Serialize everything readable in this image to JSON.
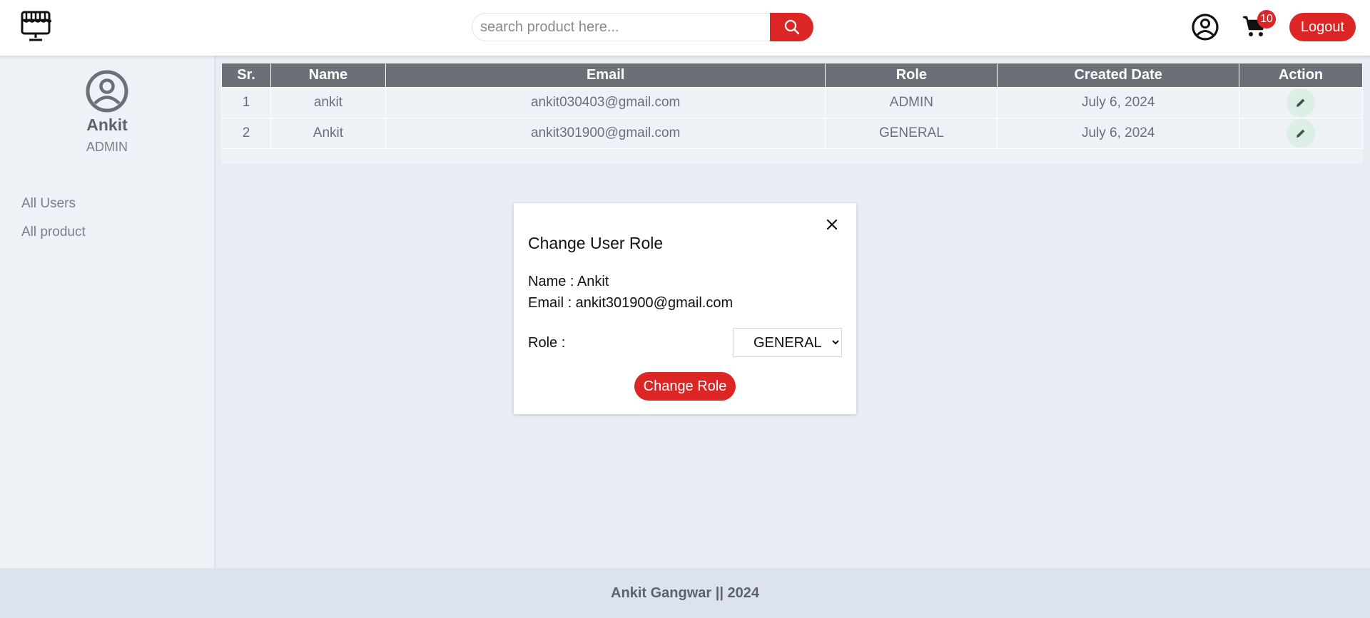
{
  "header": {
    "logo_icon": "storefront-monitor-icon",
    "search_placeholder": "search product here...",
    "search_icon": "search-icon",
    "user_icon": "user-circle-icon",
    "cart_icon": "cart-icon",
    "cart_count": "10",
    "logout_label": "Logout"
  },
  "sidebar": {
    "avatar_icon": "user-circle-icon",
    "user_name": "Ankit",
    "user_role": "ADMIN",
    "nav": [
      {
        "label": "All Users"
      },
      {
        "label": "All product"
      }
    ]
  },
  "table": {
    "headers": [
      "Sr.",
      "Name",
      "Email",
      "Role",
      "Created Date",
      "Action"
    ],
    "rows": [
      {
        "sr": "1",
        "name": "ankit",
        "email": "ankit030403@gmail.com",
        "role": "ADMIN",
        "created": "July 6, 2024",
        "action_icon": "pencil-icon"
      },
      {
        "sr": "2",
        "name": "Ankit",
        "email": "ankit301900@gmail.com",
        "role": "GENERAL",
        "created": "July 6, 2024",
        "action_icon": "pencil-icon"
      }
    ]
  },
  "modal": {
    "title": "Change User Role",
    "close_icon": "close-icon",
    "name_line": "Name : Ankit",
    "email_line": "Email : ankit301900@gmail.com",
    "role_label": "Role :",
    "role_selected": "GENERAL",
    "submit_label": "Change Role"
  },
  "footer": {
    "text": "Ankit Gangwar || 2024"
  },
  "colors": {
    "accent": "#dc2626",
    "table_header": "#6b7078",
    "page_bg": "#e8ecf3"
  }
}
